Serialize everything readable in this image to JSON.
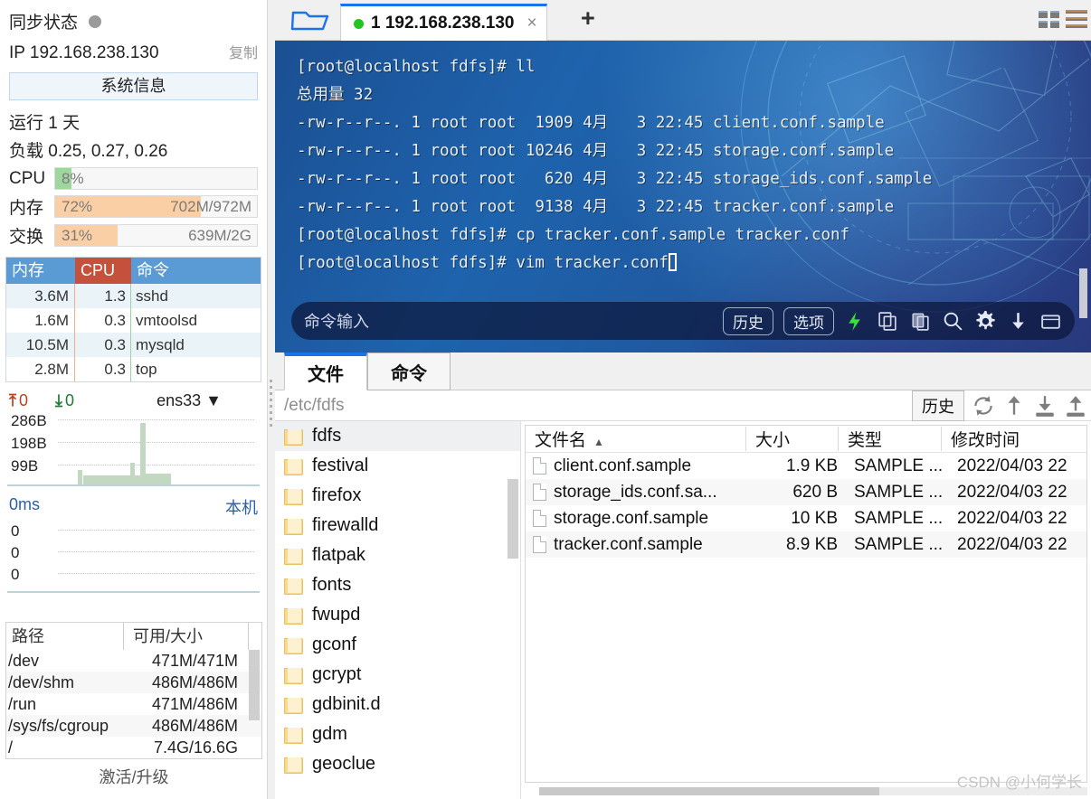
{
  "sidebar": {
    "sync_title": "同步状态",
    "ip_label": "IP 192.168.238.130",
    "copy_label": "复制",
    "sysinfo_button": "系统信息",
    "uptime": "运行 1 天",
    "loadavg": "负载 0.25, 0.27, 0.26",
    "meters": [
      {
        "label": "CPU",
        "pct": "8%",
        "value": "",
        "fill": 8,
        "color": "#9fd6a0"
      },
      {
        "label": "内存",
        "pct": "72%",
        "value": "702M/972M",
        "fill": 72,
        "color": "#fbcfa5"
      },
      {
        "label": "交换",
        "pct": "31%",
        "value": "639M/2G",
        "fill": 31,
        "color": "#fbcfa5"
      }
    ],
    "proc_table": {
      "headers": [
        "内存",
        "CPU",
        "命令"
      ],
      "rows": [
        {
          "mem": "3.6M",
          "cpu": "1.3",
          "cmd": "sshd"
        },
        {
          "mem": "1.6M",
          "cpu": "0.3",
          "cmd": "vmtoolsd"
        },
        {
          "mem": "10.5M",
          "cpu": "0.3",
          "cmd": "mysqld"
        },
        {
          "mem": "2.8M",
          "cpu": "0.3",
          "cmd": "top"
        }
      ]
    },
    "network": {
      "up_value": "0",
      "down_value": "0",
      "interface": "ens33",
      "y_labels": [
        "286B",
        "198B",
        "99B"
      ]
    },
    "latency": {
      "ms_label": "0ms",
      "host_label": "本机",
      "y_labels": [
        "0",
        "0",
        "0"
      ]
    },
    "disk_table": {
      "headers": [
        "路径",
        "可用/大小"
      ],
      "rows": [
        {
          "path": "/dev",
          "size": "471M/471M"
        },
        {
          "path": "/dev/shm",
          "size": "486M/486M"
        },
        {
          "path": "/run",
          "size": "471M/486M"
        },
        {
          "path": "/sys/fs/cgroup",
          "size": "486M/486M"
        },
        {
          "path": "/",
          "size": "7.4G/16.6G"
        }
      ]
    },
    "activate_label": "激活/升级"
  },
  "terminal": {
    "tab": {
      "title": "1 192.168.238.130",
      "close": "×",
      "new_tab": "+"
    },
    "lines": [
      "[root@localhost fdfs]# ll",
      "总用量 32",
      "-rw-r--r--. 1 root root  1909 4月   3 22:45 client.conf.sample",
      "-rw-r--r--. 1 root root 10246 4月   3 22:45 storage.conf.sample",
      "-rw-r--r--. 1 root root   620 4月   3 22:45 storage_ids.conf.sample",
      "-rw-r--r--. 1 root root  9138 4月   3 22:45 tracker.conf.sample",
      "[root@localhost fdfs]# cp tracker.conf.sample tracker.conf",
      "[root@localhost fdfs]# vim tracker.conf"
    ],
    "cmdbar": {
      "placeholder": "命令输入",
      "history_label": "历史",
      "options_label": "选项",
      "icons": [
        "bolt-icon",
        "copy-icon",
        "paste-icon",
        "search-icon",
        "gear-icon",
        "download-icon",
        "window-icon"
      ]
    }
  },
  "file_manager": {
    "tabs": [
      {
        "label": "文件",
        "active": true
      },
      {
        "label": "命令",
        "active": false
      }
    ],
    "path": "/etc/fdfs",
    "toolbar": {
      "history_label": "历史",
      "icons": [
        "refresh-icon",
        "sort-icon",
        "download-icon",
        "upload-icon"
      ]
    },
    "tree": [
      {
        "name": "fdfs",
        "selected": true
      },
      {
        "name": "festival",
        "selected": false
      },
      {
        "name": "firefox",
        "selected": false
      },
      {
        "name": "firewalld",
        "selected": false
      },
      {
        "name": "flatpak",
        "selected": false
      },
      {
        "name": "fonts",
        "selected": false
      },
      {
        "name": "fwupd",
        "selected": false
      },
      {
        "name": "gconf",
        "selected": false
      },
      {
        "name": "gcrypt",
        "selected": false
      },
      {
        "name": "gdbinit.d",
        "selected": false
      },
      {
        "name": "gdm",
        "selected": false
      },
      {
        "name": "geoclue",
        "selected": false
      }
    ],
    "list": {
      "headers": [
        "文件名",
        "大小",
        "类型",
        "修改时间"
      ],
      "sort_indicator": "▲",
      "rows": [
        {
          "name": "client.conf.sample",
          "size": "1.9 KB",
          "type": "SAMPLE ...",
          "time": "2022/04/03 22"
        },
        {
          "name": "storage_ids.conf.sa...",
          "size": "620 B",
          "type": "SAMPLE ...",
          "time": "2022/04/03 22"
        },
        {
          "name": "storage.conf.sample",
          "size": "10 KB",
          "type": "SAMPLE ...",
          "time": "2022/04/03 22"
        },
        {
          "name": "tracker.conf.sample",
          "size": "8.9 KB",
          "type": "SAMPLE ...",
          "time": "2022/04/03 22"
        }
      ]
    },
    "watermark": "CSDN @小何学长"
  }
}
